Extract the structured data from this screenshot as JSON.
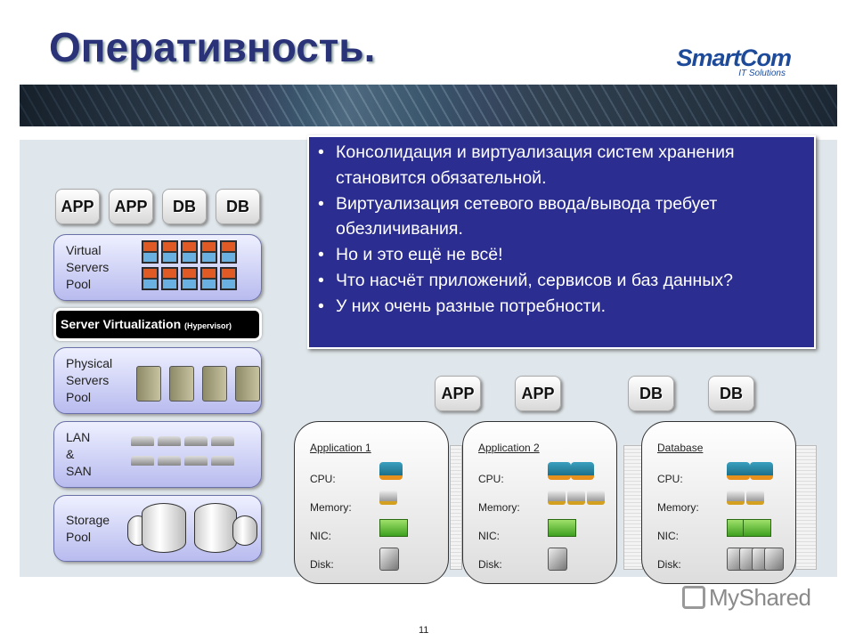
{
  "title": "Оперативность.",
  "logo": {
    "brand": "SmartCom",
    "tagline": "IT Solutions"
  },
  "stack": {
    "tiles": [
      "APP",
      "APP",
      "DB",
      "DB"
    ],
    "virtual_pool": [
      "Virtual",
      "Servers",
      "Pool"
    ],
    "hypervisor": {
      "main": "Server Virtualization",
      "sub": "(Hypervisor)"
    },
    "physical_pool": [
      "Physical",
      "Servers",
      "Pool"
    ],
    "network": [
      "LAN",
      "&",
      "SAN"
    ],
    "storage": [
      "Storage",
      "Pool"
    ]
  },
  "bullets": [
    "Консолидация и виртуализация систем хранения становится обязательной.",
    "Виртуализация сетевого ввода/вывода требует обезличивания.",
    "Но и это ещё не всё!",
    "Что насчёт приложений, сервисов и баз данных?",
    "У них очень разные потребности."
  ],
  "workload_tiles": [
    "APP",
    "APP",
    "DB",
    "DB"
  ],
  "cards": [
    {
      "title": "Application 1",
      "cpu": 1,
      "memory": 1,
      "nic": 1,
      "disk": 1
    },
    {
      "title": "Application 2",
      "cpu": 2,
      "memory": 3,
      "nic": 1,
      "disk": 1
    },
    {
      "title": "Database",
      "cpu": 2,
      "memory": 2,
      "nic": 2,
      "disk": 4
    }
  ],
  "row_labels": {
    "cpu": "CPU:",
    "memory": "Memory:",
    "nic": "NIC:",
    "disk": "Disk:"
  },
  "page_number": "11",
  "watermark": "MyShared",
  "colors": {
    "title": "#2a3278",
    "bluebox": "#2b2e90",
    "content_bg": "#dfe7ec"
  }
}
